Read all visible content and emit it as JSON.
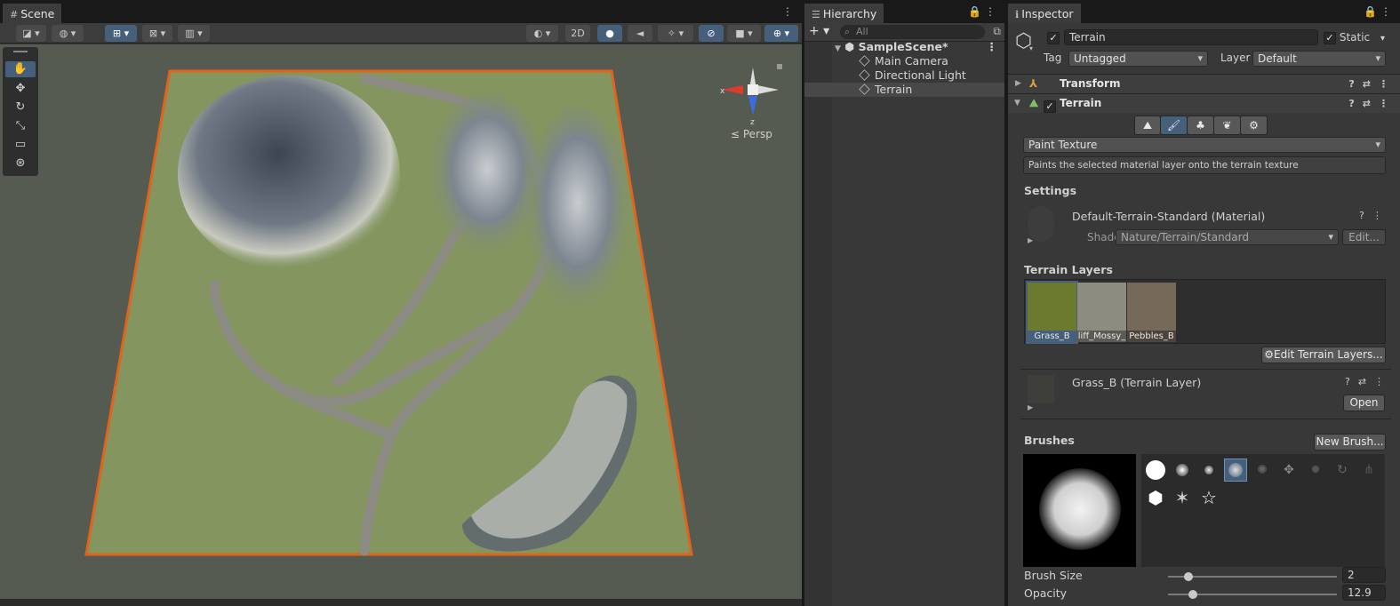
{
  "scene": {
    "tab_label": "Scene",
    "toolbar": {
      "mode_2d": "2D"
    },
    "persp_label": "Persp",
    "axis_x": "x",
    "axis_z": "z"
  },
  "hierarchy": {
    "tab_label": "Hierarchy",
    "search_placeholder": "All",
    "scene_name": "SampleScene*",
    "items": [
      "Main Camera",
      "Directional Light",
      "Terrain"
    ],
    "selected": "Terrain"
  },
  "inspector": {
    "tab_label": "Inspector",
    "object_name": "Terrain",
    "static_label": "Static",
    "tag_label": "Tag",
    "tag_value": "Untagged",
    "layer_label": "Layer",
    "layer_value": "Default",
    "components": {
      "transform": "Transform",
      "terrain": "Terrain"
    },
    "tool_mode": "Paint Texture",
    "tool_description": "Paints the selected material layer onto the terrain texture",
    "settings_label": "Settings",
    "material_name": "Default-Terrain-Standard (Material)",
    "shader_label": "Shader",
    "shader_value": "Nature/Terrain/Standard",
    "edit_label": "Edit...",
    "terrain_layers_label": "Terrain Layers",
    "layers": [
      {
        "name": "Grass_B",
        "color": "#6b7a2e",
        "selected": true
      },
      {
        "name": "Cliff_Mossy_",
        "display": "liff_Mossy_",
        "color": "#8d8c80"
      },
      {
        "name": "Pebbles_B",
        "display": "Pebbles_B",
        "color": "#75695a"
      }
    ],
    "edit_layers_button": "Edit Terrain Layers...",
    "layer_asset": "Grass_B (Terrain Layer)",
    "open_button": "Open",
    "brushes_label": "Brushes",
    "new_brush_button": "New Brush...",
    "brush_size_label": "Brush Size",
    "brush_size_value": "2",
    "opacity_label": "Opacity",
    "opacity_value": "12.9",
    "brush_size_fraction": 0.1,
    "opacity_fraction": 0.13
  },
  "colors": {
    "selection_outline": "#e2641a",
    "accent": "#46607c",
    "terrain_green": "#84955f"
  }
}
